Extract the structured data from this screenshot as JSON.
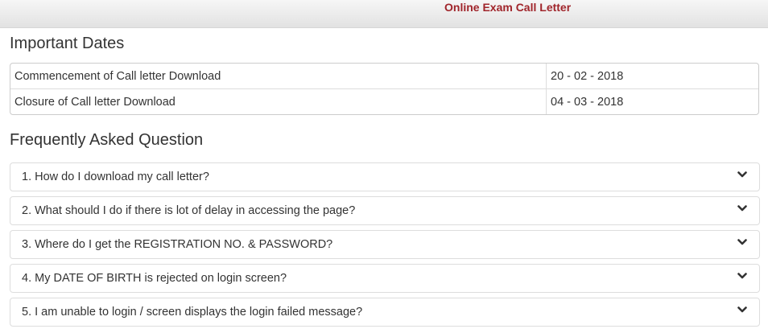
{
  "header": {
    "title": "Online Exam Call Letter"
  },
  "important_dates": {
    "heading": "Important Dates",
    "rows": [
      {
        "label": "Commencement of Call letter Download",
        "value": "20 - 02 - 2018"
      },
      {
        "label": "Closure of Call letter Download",
        "value": "04 - 03 - 2018"
      }
    ]
  },
  "faq": {
    "heading": "Frequently Asked Question",
    "items": [
      {
        "question": "1. How do I download my call letter?",
        "icon": "chevron-down-icon"
      },
      {
        "question": "2. What should I do if there is lot of delay in accessing the page?",
        "icon": "chevron-down-icon"
      },
      {
        "question": "3. Where do I get the REGISTRATION NO. & PASSWORD?",
        "icon": "chevron-down-icon"
      },
      {
        "question": "4. My DATE OF BIRTH is rejected on login screen?",
        "icon": "chevron-down-icon"
      },
      {
        "question": "5. I am unable to login / screen displays the login failed message?",
        "icon": "chevron-down-icon"
      }
    ]
  },
  "colors": {
    "title_red": "#a0252b",
    "text": "#333333",
    "border": "#dddddd"
  }
}
